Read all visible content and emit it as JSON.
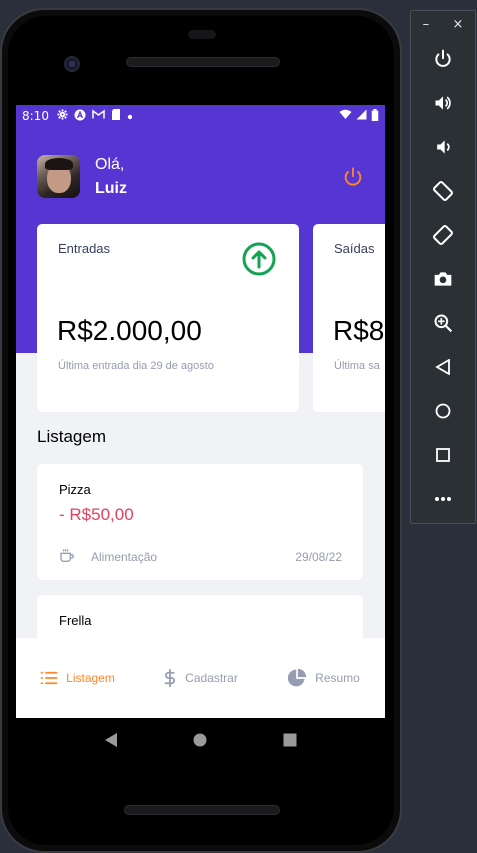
{
  "status_bar": {
    "time": "8:10"
  },
  "header": {
    "greeting": "Olá,",
    "user_name": "Luiz"
  },
  "cards": [
    {
      "title": "Entradas",
      "amount": "R$2.000,00",
      "subtitle": "Última entrada dia 29 de agosto",
      "icon": "arrow-up-circle-icon"
    },
    {
      "title": "Saídas",
      "amount": "R$8",
      "subtitle": "Última sa",
      "icon": "arrow-down-circle-icon"
    }
  ],
  "listing": {
    "title": "Listagem",
    "transactions": [
      {
        "title": "Pizza",
        "amount": "- R$50,00",
        "category": "Alimentação",
        "category_icon": "coffee-icon",
        "date": "29/08/22"
      },
      {
        "title": "Frella",
        "amount": "",
        "category": "",
        "date": ""
      }
    ]
  },
  "tabs": [
    {
      "label": "Listagem",
      "icon": "list-icon",
      "active": true
    },
    {
      "label": "Cadastrar",
      "icon": "dollar-sign-icon",
      "active": false
    },
    {
      "label": "Resumo",
      "icon": "pie-chart-icon",
      "active": false
    }
  ],
  "colors": {
    "primary": "#5636d3",
    "secondary": "#ff872c",
    "success": "#12a454",
    "attention": "#e83f5b",
    "text": "#969cb2",
    "background": "#f0f2f5"
  },
  "emulator_controls": {
    "close": "×",
    "minimize": "–",
    "buttons": [
      "power-icon",
      "volume-up-icon",
      "volume-down-icon",
      "rotate-left-icon",
      "rotate-right-icon",
      "camera-icon",
      "zoom-icon",
      "back-icon",
      "home-icon",
      "overview-icon",
      "more-icon"
    ]
  }
}
